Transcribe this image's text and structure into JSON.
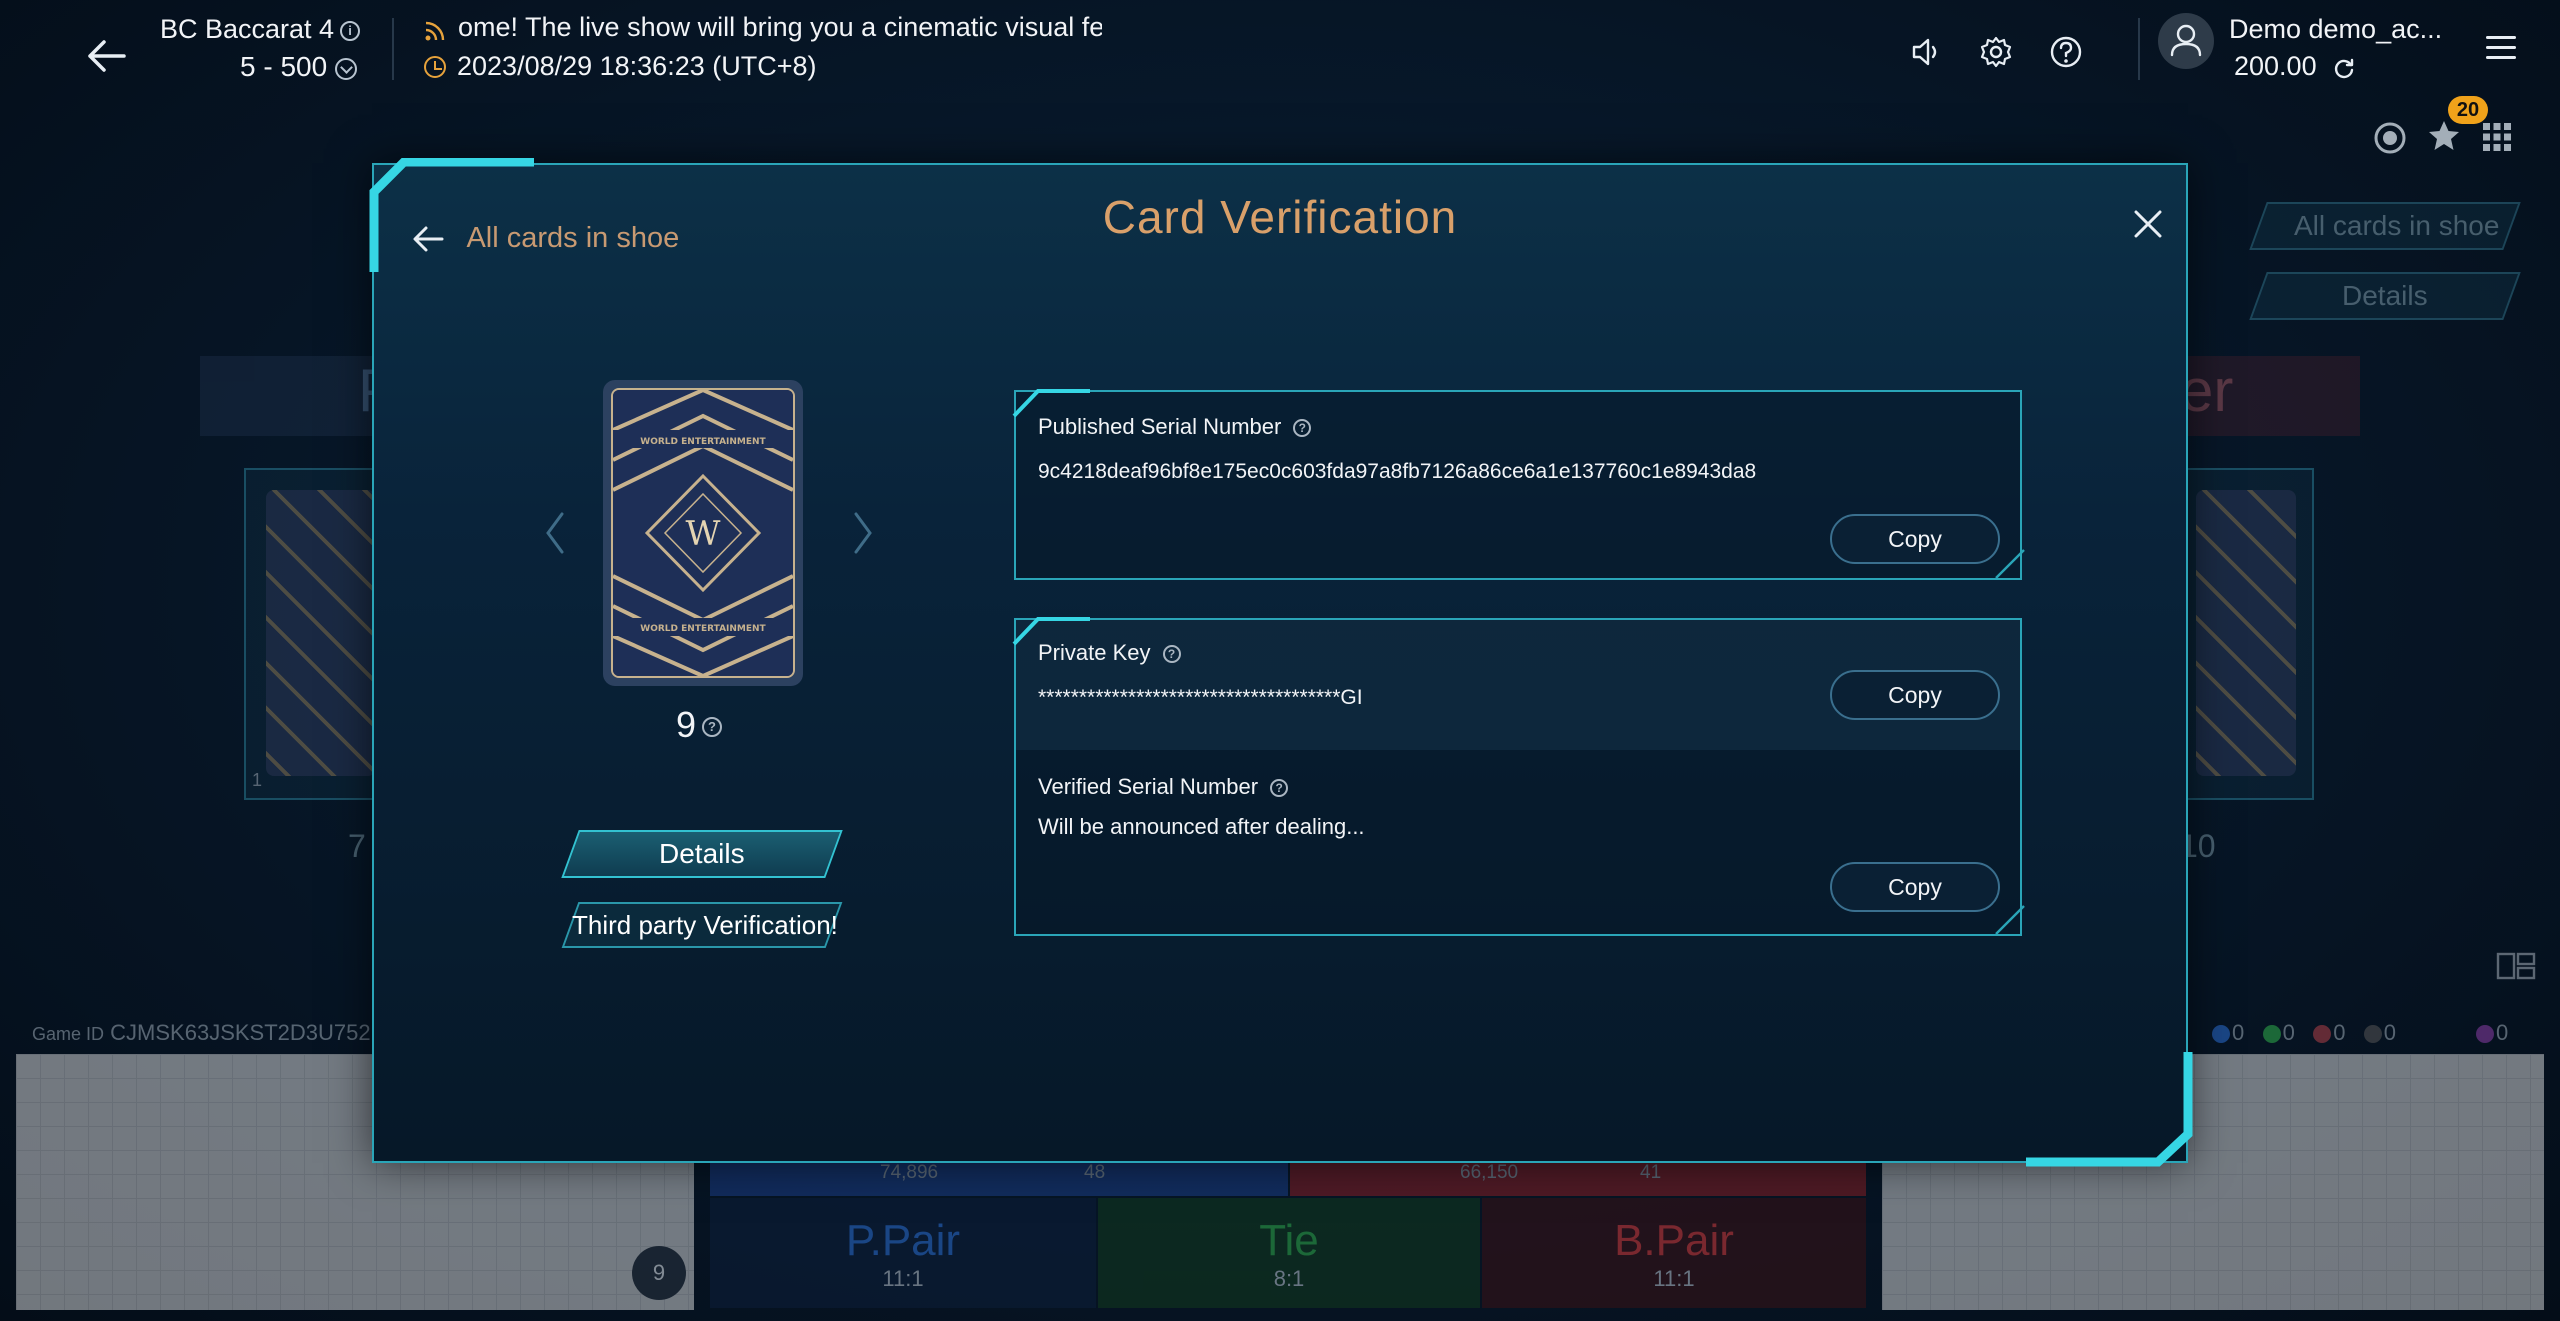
{
  "topbar": {
    "table_name": "BC Baccarat 4",
    "limit": "5 - 500",
    "marquee": "ome! The live show will bring you a cinematic visual fea",
    "datetime": "2023/08/29 18:36:23 (UTC+8)",
    "user_name": "Demo demo_ac...",
    "balance": "200.00",
    "favorites_count": "20"
  },
  "background": {
    "tab_all_cards": "All cards in shoe",
    "tab_details": "Details",
    "game_id_label": "Game ID",
    "game_id": "CJMSK63JSKST2D3U752",
    "player_total": "74,896",
    "player_count": "48",
    "banker_total": "66,150",
    "banker_count": "41",
    "bets": [
      {
        "label": "P.Pair",
        "odds": "11:1",
        "color": "#2b6fd6"
      },
      {
        "label": "Tie",
        "odds": "8:1",
        "color": "#2fae4a"
      },
      {
        "label": "B.Pair",
        "odds": "11:1",
        "color": "#d93a3a"
      }
    ],
    "road_counts": [
      "0",
      "0",
      "0",
      "0",
      "0"
    ],
    "shoe_count": "9",
    "left_card_index": "1",
    "left_score": "7",
    "right_score": "10",
    "left_side_title": "P",
    "right_side_title": "er"
  },
  "modal": {
    "title": "Card Verification",
    "back_label": "All cards in shoe",
    "card_number": "9",
    "card_brand": "WORLD ENTERTAINMENT",
    "card_logo": "W",
    "details_label": "Details",
    "third_party_label": "Third party Verification!",
    "published": {
      "label": "Published Serial Number",
      "value": "9c4218deaf96bf8e175ec0c603fda97a8fb7126a86ce6a1e137760c1e8943da8",
      "copy": "Copy"
    },
    "private_key": {
      "label": "Private Key",
      "value": "*************************************GI",
      "copy": "Copy"
    },
    "verified": {
      "label": "Verified Serial Number",
      "value": "Will be announced after dealing...",
      "copy": "Copy"
    }
  },
  "colors": {
    "accent": "#2aa5b8",
    "title": "#d9a06a",
    "badge": "#f0a21a"
  }
}
